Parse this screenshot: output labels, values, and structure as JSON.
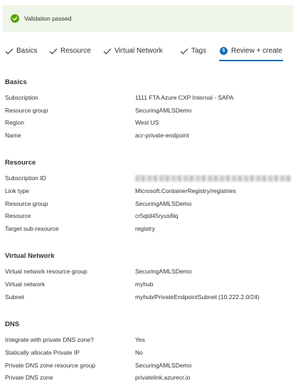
{
  "banner": {
    "text": "Validation passed",
    "status_color": "#57a300"
  },
  "tabs": [
    {
      "label": "Basics",
      "state": "completed"
    },
    {
      "label": "Resource",
      "state": "completed"
    },
    {
      "label": "Virtual Network",
      "state": "completed"
    },
    {
      "label": "Tags",
      "state": "completed"
    },
    {
      "label": "Review + create",
      "state": "active",
      "step": "5"
    }
  ],
  "accent_color": "#0f6cbd",
  "sections": {
    "basics": {
      "title": "Basics",
      "rows": [
        {
          "label": "Subscription",
          "value": "1111 FTA Azure CXP Internal - SAPA"
        },
        {
          "label": "Resource group",
          "value": "SecuringAMLSDemo"
        },
        {
          "label": "Region",
          "value": "West US"
        },
        {
          "label": "Name",
          "value": "acr-private-endpoint"
        }
      ]
    },
    "resource": {
      "title": "Resource",
      "rows": [
        {
          "label": "Subscription ID",
          "value": "",
          "redacted": true
        },
        {
          "label": "Link type",
          "value": "Microsoft.ContainerRegistry/registries"
        },
        {
          "label": "Resource group",
          "value": "SecuringAMLSDemo"
        },
        {
          "label": "Resource",
          "value": "cr5qtd45ryus6lq"
        },
        {
          "label": "Target sub-resource",
          "value": "registry"
        }
      ]
    },
    "virtual_network": {
      "title": "Virtual Network",
      "rows": [
        {
          "label": "Virtual network resource group",
          "value": "SecuringAMLSDemo"
        },
        {
          "label": "Virtual network",
          "value": "myhub"
        },
        {
          "label": "Subnet",
          "value": "myhub/PrivateEndpointSubnet (10.222.2.0/24)"
        }
      ]
    },
    "dns": {
      "title": "DNS",
      "rows": [
        {
          "label": "Integrate with private DNS zone?",
          "value": "Yes"
        },
        {
          "label": "Statically allocate Private IP",
          "value": "No"
        },
        {
          "label": "Private DNS zone resource group",
          "value": "SecuringAMLSDemo"
        },
        {
          "label": "Private DNS zone",
          "value": "privatelink.azurecr.io"
        }
      ]
    }
  }
}
